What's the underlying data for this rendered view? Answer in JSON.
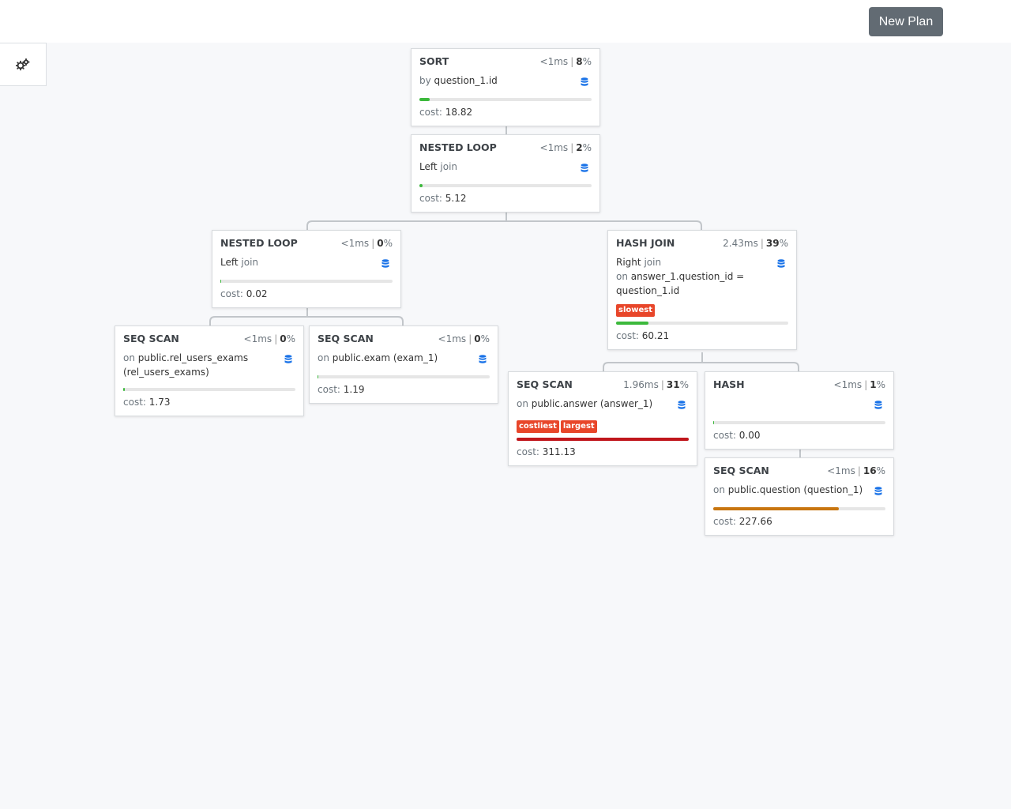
{
  "toolbar": {
    "new_plan_label": "New Plan"
  },
  "settings": {
    "icon": "gears-icon"
  },
  "node_icon": "database-icon",
  "nodes": {
    "sort": {
      "type": "SORT",
      "time": "<1ms",
      "percent": "8",
      "detail_prefix": "by",
      "detail": "question_1.id",
      "cost_label": "cost:",
      "cost": "18.82",
      "cost_fraction": 0.06,
      "bar_color": "#3cb93c"
    },
    "nested_loop_1": {
      "type": "NESTED LOOP",
      "time": "<1ms",
      "percent": "2",
      "detail_main": "Left",
      "detail_suffix": "join",
      "cost_label": "cost:",
      "cost": "5.12",
      "cost_fraction": 0.02,
      "bar_color": "#3cb93c"
    },
    "nested_loop_2": {
      "type": "NESTED LOOP",
      "time": "<1ms",
      "percent": "0",
      "detail_main": "Left",
      "detail_suffix": "join",
      "cost_label": "cost:",
      "cost": "0.02",
      "cost_fraction": 0.0,
      "bar_color": "#3cb93c"
    },
    "hash_join": {
      "type": "HASH JOIN",
      "time": "2.43ms",
      "percent": "39",
      "detail_main": "Right",
      "detail_suffix": "join",
      "cond_prefix": "on",
      "condition": "answer_1.question_id = question_1.id",
      "tags": [
        "slowest"
      ],
      "cost_label": "cost:",
      "cost": "60.21",
      "cost_fraction": 0.19,
      "bar_color": "#3cb93c"
    },
    "seq_scan_rel_users_exams": {
      "type": "SEQ SCAN",
      "time": "<1ms",
      "percent": "0",
      "detail_prefix": "on",
      "detail": "public.rel_users_exams (rel_users_exams)",
      "cost_label": "cost:",
      "cost": "1.73",
      "cost_fraction": 0.01,
      "bar_color": "#3cb93c"
    },
    "seq_scan_exam": {
      "type": "SEQ SCAN",
      "time": "<1ms",
      "percent": "0",
      "detail_prefix": "on",
      "detail": "public.exam (exam_1)",
      "cost_label": "cost:",
      "cost": "1.19",
      "cost_fraction": 0.0,
      "bar_color": "#3cb93c"
    },
    "seq_scan_answer": {
      "type": "SEQ SCAN",
      "time": "1.96ms",
      "percent": "31",
      "detail_prefix": "on",
      "detail": "public.answer (answer_1)",
      "tags": [
        "costliest",
        "largest"
      ],
      "cost_label": "cost:",
      "cost": "311.13",
      "cost_fraction": 1.0,
      "bar_color": "#c0161c"
    },
    "hash": {
      "type": "HASH",
      "time": "<1ms",
      "percent": "1",
      "cost_label": "cost:",
      "cost": "0.00",
      "cost_fraction": 0.0,
      "bar_color": "#3cb93c"
    },
    "seq_scan_question": {
      "type": "SEQ SCAN",
      "time": "<1ms",
      "percent": "16",
      "detail_prefix": "on",
      "detail": "public.question (question_1)",
      "cost_label": "cost:",
      "cost": "227.66",
      "cost_fraction": 0.73,
      "bar_color": "#c8750f"
    }
  }
}
